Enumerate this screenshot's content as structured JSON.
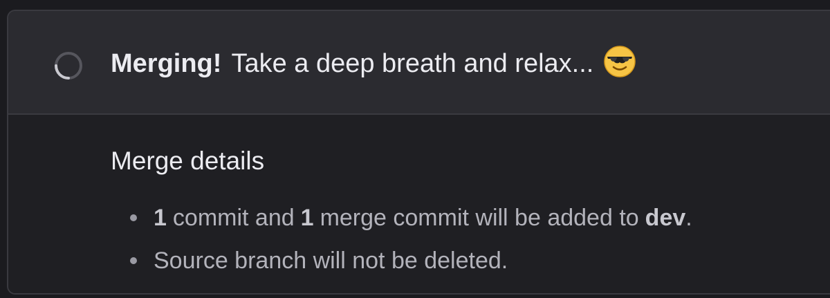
{
  "status": {
    "label": "Merging!",
    "message": "Take a deep breath and relax...",
    "spinner_icon": "spinner-icon",
    "emoji_icon": "smiling-face-with-sunglasses-icon",
    "colors": {
      "header_bg": "#2b2b30",
      "body_bg": "#1f1f23",
      "border": "#3a3a40",
      "text_primary": "#ececf1",
      "text_secondary": "#b3b3bb"
    }
  },
  "merge_details": {
    "title": "Merge details",
    "items": [
      {
        "commit_count": "1",
        "commit_text": "commit and",
        "merge_commit_count": "1",
        "merge_commit_text": "merge commit will be added to",
        "branch": "dev",
        "end": "."
      },
      {
        "text": "Source branch will not be deleted."
      }
    ]
  }
}
